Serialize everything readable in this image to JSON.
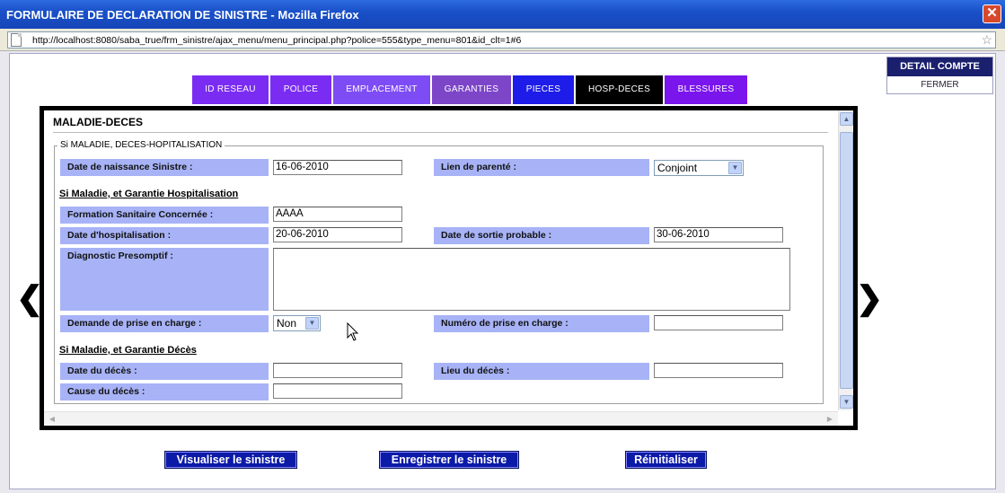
{
  "window": {
    "title": "FORMULAIRE DE DECLARATION DE SINISTRE - Mozilla Firefox",
    "close_glyph": "✕"
  },
  "browser": {
    "url": "http://localhost:8080/saba_true/frm_sinistre/ajax_menu/menu_principal.php?police=555&type_menu=801&id_clt=1#6",
    "star_glyph": "☆"
  },
  "tabs": [
    {
      "label": "ID RESEAU",
      "color": "#7b2cf2"
    },
    {
      "label": "POLICE",
      "color": "#7b2cf2"
    },
    {
      "label": "EMPLACEMENT",
      "color": "#7e4cf4"
    },
    {
      "label": "GARANTIES",
      "color": "#7d46c9"
    },
    {
      "label": "PIECES",
      "color": "#1d1ce8"
    },
    {
      "label": "HOSP-DECES",
      "color": "#000000",
      "active": true
    },
    {
      "label": "BLESSURES",
      "color": "#7b15ee"
    }
  ],
  "detail_box": {
    "title": "DETAIL COMPTE",
    "close_label": "FERMER"
  },
  "nav": {
    "prev_glyph": "❮",
    "next_glyph": "❯"
  },
  "form": {
    "section_title": "MALADIE-DECES",
    "legend": "Si MALADIE, DECES-HOPITALISATION",
    "dob_label": "Date de naissance Sinistre :",
    "dob_value": "16-06-2010",
    "relation_label": "Lien de parenté :",
    "relation_value": "Conjoint",
    "hosp_subhead": "Si Maladie, et Garantie Hospitalisation",
    "facility_label": "Formation Sanitaire Concernée :",
    "facility_value": "AAAA",
    "hosp_date_label": "Date d'hospitalisation :",
    "hosp_date_value": "20-06-2010",
    "discharge_label": "Date de sortie probable :",
    "discharge_value": "30-06-2010",
    "diagnosis_label": "Diagnostic Presomptif :",
    "diagnosis_value": "",
    "request_label": "Demande de prise en charge :",
    "request_value": "Non",
    "request_number_label": "Numéro de prise en charge :",
    "request_number_value": "",
    "death_subhead": "Si Maladie, et Garantie Décès",
    "death_date_label": "Date du décès :",
    "death_date_value": "",
    "death_place_label": "Lieu du décès :",
    "death_place_value": "",
    "death_cause_label": "Cause du décès :",
    "death_cause_value": ""
  },
  "buttons": {
    "view": "Visualiser le sinistre",
    "save": "Enregistrer le sinistre",
    "reset": "Réinitialiser"
  },
  "colors": {
    "label_bg": "#a7b3f6",
    "button_bg": "#0c1aa8",
    "titlebar": "#1950c8"
  }
}
